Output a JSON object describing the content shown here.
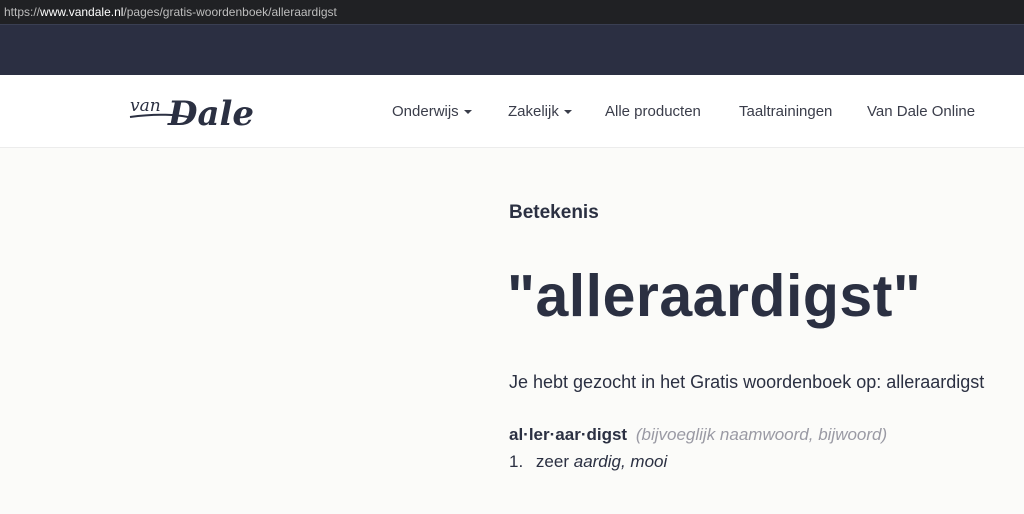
{
  "browser": {
    "url_prefix": "https://",
    "url_host": "www.vandale.nl",
    "url_path": "/pages/gratis-woordenboek/alleraardigst"
  },
  "header": {
    "logo_text": "van Dale",
    "nav": [
      {
        "label": "Onderwijs",
        "dropdown": true
      },
      {
        "label": "Zakelijk",
        "dropdown": true
      },
      {
        "label": "Alle producten",
        "dropdown": false
      },
      {
        "label": "Taaltrainingen",
        "dropdown": false
      },
      {
        "label": "Van Dale Online",
        "dropdown": false
      }
    ]
  },
  "main": {
    "section_label": "Betekenis",
    "headword": "\"alleraardigst\"",
    "searched_text": "Je hebt gezocht in het Gratis woordenboek op: alleraardigst",
    "entry_word": "al·ler·aar·digst",
    "entry_pos": "(bijvoeglijk naamwoord, bijwoord)",
    "definitions": [
      {
        "num": "1.",
        "prefix": "zeer",
        "meaning": "aardig, mooi"
      }
    ]
  },
  "colors": {
    "dark_band": "#2b2f42",
    "text": "#2b3042",
    "muted": "#9a9aa4",
    "background": "#fbfbf9"
  }
}
